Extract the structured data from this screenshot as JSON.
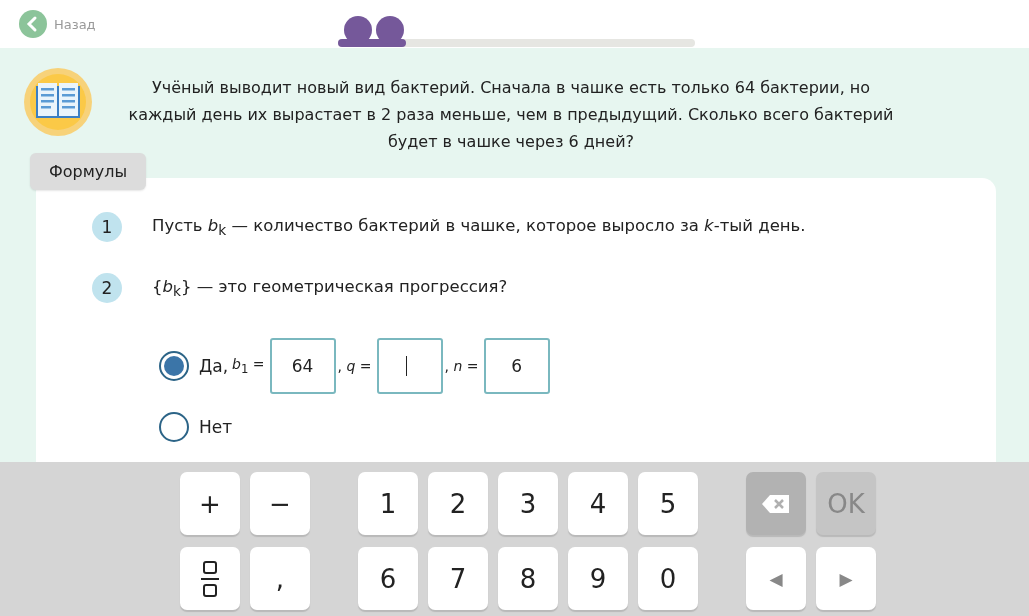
{
  "back": {
    "label": "Назад"
  },
  "progress": {
    "level": 0.19
  },
  "task": {
    "text": "Учёный выводит новый вид бактерий. Сначала в чашке есть только 64 бактерии, но каждый день их вырастает в 2 раза меньше, чем в предыдущий. Сколько всего бактерий будет в чашке через 6 дней?"
  },
  "formulas": {
    "label": "Формулы"
  },
  "steps": [
    {
      "number": "1",
      "text": "Пусть *b*$_{k}$ — количество бактерий в чашке, которое выросло за *k*-тый день."
    },
    {
      "number": "2",
      "text": "{*b*$_{k}$} — это геометрическая прогрессия?"
    }
  ],
  "options": [
    {
      "selected": true,
      "label": "Да,",
      "fields": [
        {
          "prefix": "*b*$_{1}$ =",
          "value": "64",
          "focused": false
        },
        {
          "prefix": ", *q* =",
          "focused": true
        },
        {
          "prefix": ", *n* =",
          "value": "6",
          "focused": false
        }
      ]
    },
    {
      "selected": false,
      "label": "Нет"
    }
  ],
  "keypad": [
    [
      {
        "kind": "char",
        "label": "+"
      },
      {
        "kind": "char",
        "label": "−"
      },
      {
        "kind": "char",
        "label": "1"
      },
      {
        "kind": "char",
        "label": "2"
      },
      {
        "kind": "char",
        "label": "3"
      },
      {
        "kind": "char",
        "label": "4"
      },
      {
        "kind": "char",
        "label": "5"
      },
      {
        "kind": "backspace"
      },
      {
        "kind": "ok",
        "label": "OK",
        "disabled": true
      }
    ],
    [
      {
        "kind": "fraction"
      },
      {
        "kind": "char",
        "label": ","
      },
      {
        "kind": "char",
        "label": "6"
      },
      {
        "kind": "char",
        "label": "7"
      },
      {
        "kind": "char",
        "label": "8"
      },
      {
        "kind": "char",
        "label": "9"
      },
      {
        "kind": "char",
        "label": "0"
      },
      {
        "kind": "arrow",
        "label": "◀"
      },
      {
        "kind": "arrow",
        "label": "▶"
      }
    ]
  ]
}
